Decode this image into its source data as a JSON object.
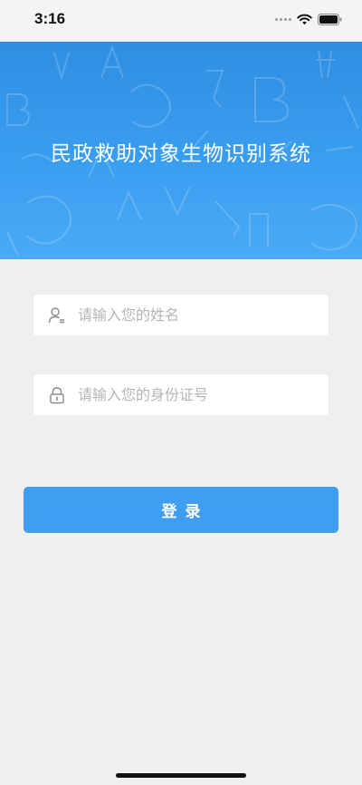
{
  "status_bar": {
    "time": "3:16"
  },
  "banner": {
    "title": "民政救助对象生物识别系统"
  },
  "form": {
    "name_placeholder": "请输入您的姓名",
    "name_value": "",
    "name_icon": "user-icon",
    "id_placeholder": "请输入您的身份证号",
    "id_value": "",
    "id_icon": "lock-icon"
  },
  "login_button": {
    "label": "登录"
  },
  "colors": {
    "accent": "#3f9ef0",
    "banner_top": "#2f8ee2",
    "background": "#efefef"
  }
}
